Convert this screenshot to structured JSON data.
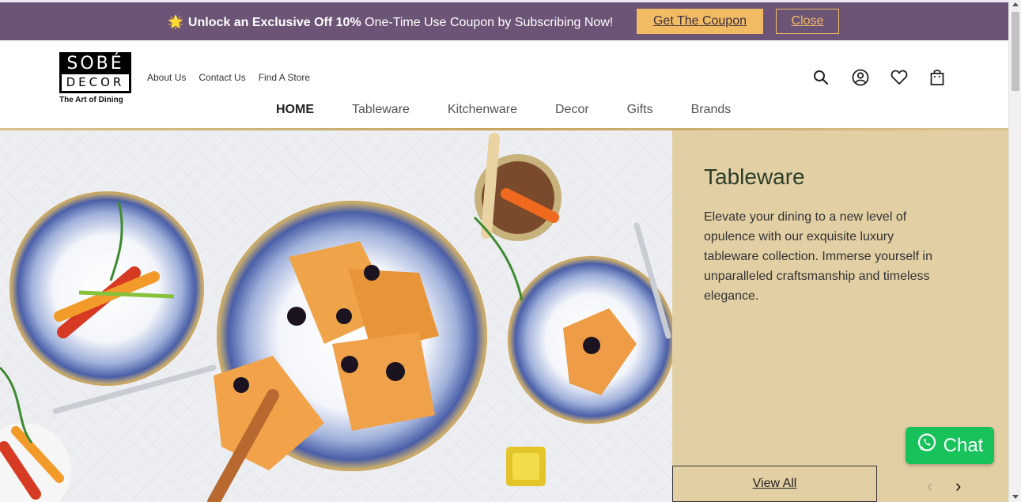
{
  "announcement": {
    "star": "🌟",
    "bold_text": "Unlock an Exclusive Off 10%",
    "text": " One-Time Use Coupon by Subscribing Now!",
    "coupon_button": "Get The Coupon",
    "close_button": "Close"
  },
  "logo": {
    "top": "SOBÉ",
    "bottom": "DECOR",
    "tagline": "The Art of Dining"
  },
  "top_links": [
    "About Us",
    "Contact Us",
    "Find A Store"
  ],
  "nav": [
    "HOME",
    "Tableware",
    "Kitchenware",
    "Decor",
    "Gifts",
    "Brands"
  ],
  "icons": [
    "search-icon",
    "account-icon",
    "wishlist-heart-icon",
    "cart-bag-icon"
  ],
  "hero": {
    "title": "Tableware",
    "description": "Elevate your dining to a new level of opulence with our exquisite luxury tableware collection. Immerse yourself in unparalleled craftsmanship and timeless elegance.",
    "view_all": "View All",
    "prev_arrow": "‹",
    "next_arrow": "›"
  },
  "chat": {
    "label": "Chat"
  },
  "colors": {
    "announcement_bg": "#6c5477",
    "coupon_button": "#f0bb63",
    "hero_panel_bg": "#e2cfa4",
    "chat_green": "#17c25a",
    "title_color": "#2d3e2b"
  }
}
